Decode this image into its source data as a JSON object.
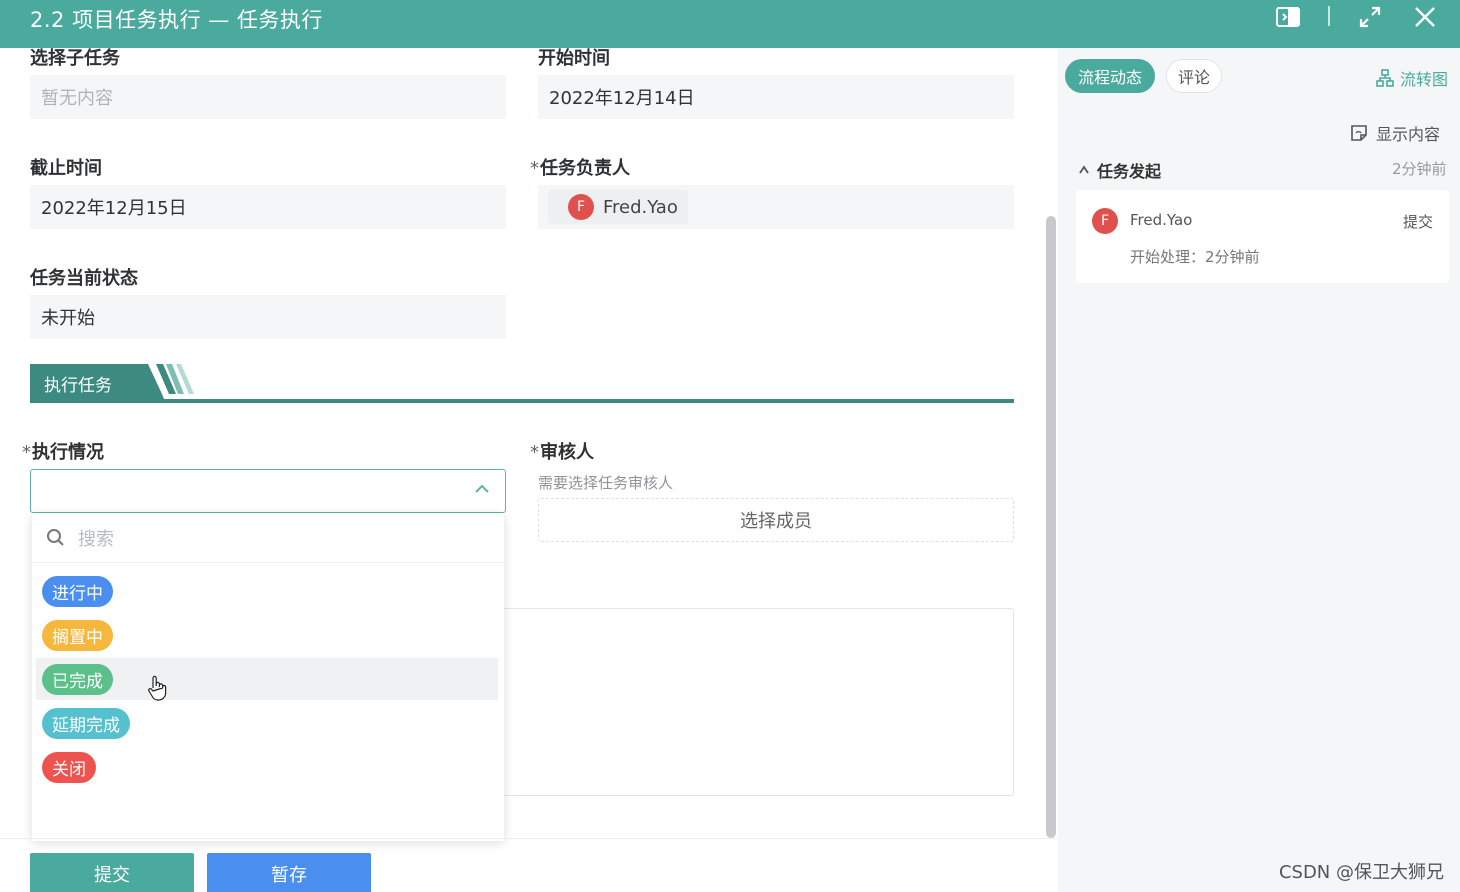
{
  "window": {
    "title": "2.2 项目任务执行 — 任务执行",
    "controls": [
      "sidebar-toggle-icon",
      "maximize-icon",
      "close-icon"
    ]
  },
  "form": {
    "subtask": {
      "label": "选择子任务",
      "value": "暂无内容"
    },
    "start_time": {
      "label": "开始时间",
      "value": "2022年12月14日"
    },
    "deadline": {
      "label": "截止时间",
      "value": "2022年12月15日"
    },
    "owner": {
      "label": "任务负责人",
      "required_mark": "*",
      "avatar_initial": "F",
      "name": "Fred.Yao"
    },
    "status": {
      "label": "任务当前状态",
      "value": "未开始"
    },
    "section_title": "执行任务",
    "execution": {
      "label": "执行情况",
      "required_mark": "*",
      "value": "",
      "search_placeholder": "搜索",
      "options": [
        {
          "label": "进行中",
          "color": "#4a8ff0"
        },
        {
          "label": "搁置中",
          "color": "#f5b73c"
        },
        {
          "label": "已完成",
          "color": "#5cc08a"
        },
        {
          "label": "延期完成",
          "color": "#55c1cf"
        },
        {
          "label": "关闭",
          "color": "#ef5350"
        }
      ],
      "hovered_option": "已完成"
    },
    "reviewer": {
      "label": "审核人",
      "required_mark": "*",
      "hint": "需要选择任务审核人",
      "button": "选择成员"
    }
  },
  "footer": {
    "submit_label": "提交",
    "draft_label": "暂存",
    "submit_color": "#4aaa9e",
    "draft_color": "#4a8ff0"
  },
  "side_panel": {
    "tabs": [
      "流程动态",
      "评论"
    ],
    "active_tab": "流程动态",
    "flowchart_label": "流转图",
    "show_content_label": "显示内容",
    "group": {
      "title": "任务发起",
      "time": "2分钟前"
    },
    "entry": {
      "avatar_initial": "F",
      "name": "Fred.Yao",
      "action": "提交",
      "detail": "开始处理：2分钟前"
    }
  },
  "credit": "CSDN @保卫大狮兄",
  "colors": {
    "accent": "#4aaa9e",
    "section": "#3c8a80"
  }
}
